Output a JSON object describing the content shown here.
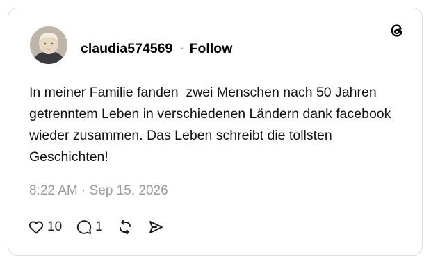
{
  "post": {
    "username": "claudia574569",
    "separator": "·",
    "follow_label": "Follow",
    "text": "In meiner Familie fanden  zwei Menschen nach 50 Jahren getrenntem Leben in verschiedenen Ländern dank facebook wieder zusammen. Das Leben schreibt die tollsten Geschichten!",
    "timestamp": "8:22 AM · Sep 15, 2026"
  },
  "actions": {
    "likes": "10",
    "replies": "1"
  },
  "icons": {
    "app_logo": "threads-logo-icon",
    "like": "heart-icon",
    "reply": "comment-icon",
    "repost": "repost-icon",
    "share": "send-icon"
  }
}
